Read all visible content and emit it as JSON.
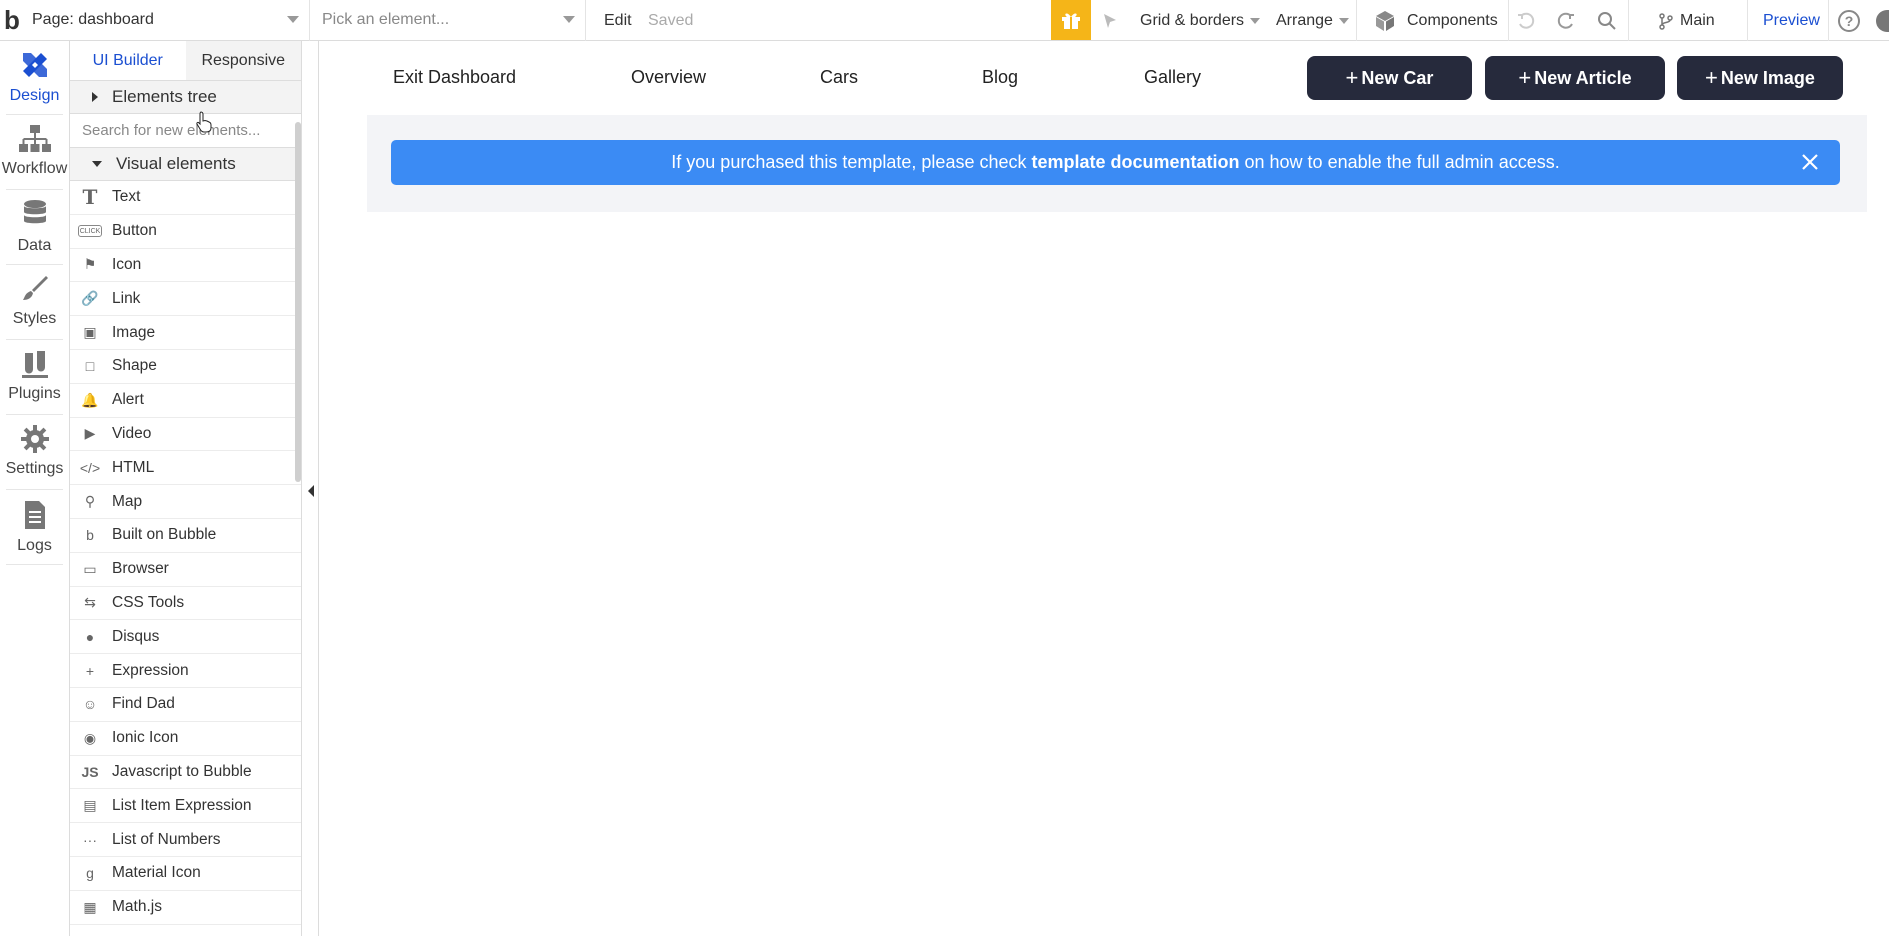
{
  "topbar": {
    "logo": "b",
    "page_label": "Page: dashboard",
    "element_placeholder": "Pick an element...",
    "edit_label": "Edit",
    "saved_label": "Saved",
    "grid_label": "Grid & borders",
    "arrange_label": "Arrange",
    "components_label": "Components",
    "branch_label": "Main",
    "preview_label": "Preview",
    "help_label": "?"
  },
  "leftnav": [
    {
      "label": "Design",
      "icon": "design-icon"
    },
    {
      "label": "Workflow",
      "icon": "workflow-icon"
    },
    {
      "label": "Data",
      "icon": "database-icon"
    },
    {
      "label": "Styles",
      "icon": "brush-icon"
    },
    {
      "label": "Plugins",
      "icon": "plug-icon"
    },
    {
      "label": "Settings",
      "icon": "gear-icon"
    },
    {
      "label": "Logs",
      "icon": "document-icon"
    }
  ],
  "panel": {
    "tabs": [
      "UI Builder",
      "Responsive"
    ],
    "elements_tree": "Elements tree",
    "search_placeholder": "Search for new elements...",
    "visual_elements": "Visual elements",
    "elements": [
      {
        "label": "Text",
        "icon": "T"
      },
      {
        "label": "Button",
        "icon": "CLICK"
      },
      {
        "label": "Icon",
        "icon": "⚑"
      },
      {
        "label": "Link",
        "icon": "🔗"
      },
      {
        "label": "Image",
        "icon": "▣"
      },
      {
        "label": "Shape",
        "icon": "□"
      },
      {
        "label": "Alert",
        "icon": "🔔"
      },
      {
        "label": "Video",
        "icon": "▶"
      },
      {
        "label": "HTML",
        "icon": "</>"
      },
      {
        "label": "Map",
        "icon": "⚲"
      },
      {
        "label": "Built on Bubble",
        "icon": "b"
      },
      {
        "label": "Browser",
        "icon": "▭"
      },
      {
        "label": "CSS Tools",
        "icon": "⇆"
      },
      {
        "label": "Disqus",
        "icon": "●"
      },
      {
        "label": "Expression",
        "icon": "+"
      },
      {
        "label": "Find Dad",
        "icon": "☺"
      },
      {
        "label": "Ionic Icon",
        "icon": "◉"
      },
      {
        "label": "Javascript to Bubble",
        "icon": "JS"
      },
      {
        "label": "List Item Expression",
        "icon": "▤"
      },
      {
        "label": "List of Numbers",
        "icon": "···"
      },
      {
        "label": "Material Icon",
        "icon": "g"
      },
      {
        "label": "Math.js",
        "icon": "▦"
      }
    ]
  },
  "canvas": {
    "nav": [
      "Exit Dashboard",
      "Overview",
      "Cars",
      "Blog",
      "Gallery"
    ],
    "buttons": [
      {
        "plus": "+",
        "label": "New Car"
      },
      {
        "plus": "+",
        "label": "New Article"
      },
      {
        "plus": "+",
        "label": "New Image"
      }
    ],
    "banner": {
      "before": "If you purchased this template, please check ",
      "bold": "template documentation",
      "after": " on how to enable the full admin access."
    }
  },
  "colors": {
    "accent": "#1b4fd1",
    "banner": "#3b8bf4",
    "pill": "#262a3c",
    "gift": "#f5b518"
  }
}
